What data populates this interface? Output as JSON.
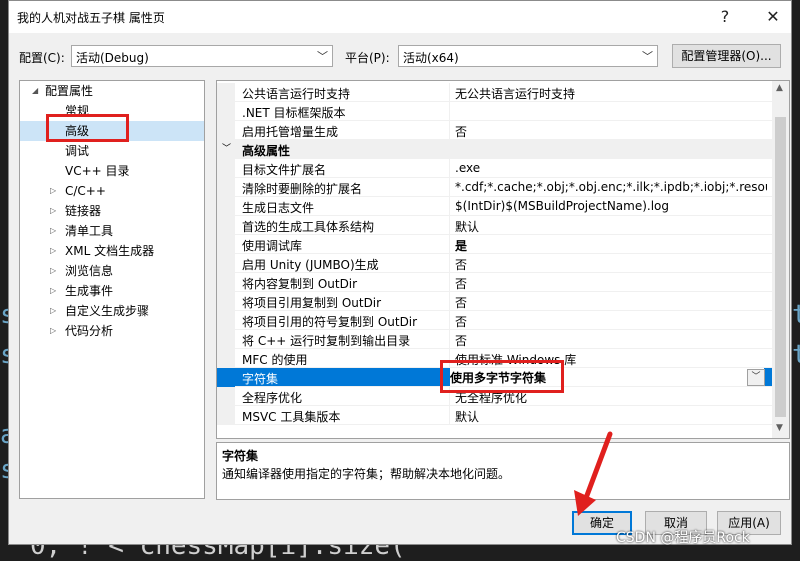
{
  "background": {
    "code_fragment": "0, ! < chessMap[i].size(",
    "left_glyphs": [
      "s",
      "s",
      "a",
      "s"
    ],
    "right_glyphs": [
      "t",
      "t"
    ]
  },
  "window": {
    "title": "我的人机对战五子棋 属性页",
    "help_label": "?",
    "close_label": "✕"
  },
  "toolbar": {
    "config_label": "配置(C):",
    "config_value": "活动(Debug)",
    "platform_label": "平台(P):",
    "platform_value": "活动(x64)",
    "config_manager_label": "配置管理器(O)..."
  },
  "tree": {
    "root": "配置属性",
    "items": [
      {
        "label": "常规",
        "expandable": false
      },
      {
        "label": "高级",
        "expandable": false,
        "selected": true
      },
      {
        "label": "调试",
        "expandable": false
      },
      {
        "label": "VC++ 目录",
        "expandable": false
      },
      {
        "label": "C/C++",
        "expandable": true
      },
      {
        "label": "链接器",
        "expandable": true
      },
      {
        "label": "清单工具",
        "expandable": true
      },
      {
        "label": "XML 文档生成器",
        "expandable": true
      },
      {
        "label": "浏览信息",
        "expandable": true
      },
      {
        "label": "生成事件",
        "expandable": true
      },
      {
        "label": "自定义生成步骤",
        "expandable": true
      },
      {
        "label": "代码分析",
        "expandable": true
      }
    ]
  },
  "grid": {
    "top_rows": [
      {
        "name": "公共语言运行时支持",
        "value": "无公共语言运行时支持"
      },
      {
        "name": ".NET 目标框架版本",
        "value": ""
      },
      {
        "name": "启用托管增量生成",
        "value": "否"
      }
    ],
    "category": "高级属性",
    "rows": [
      {
        "name": "目标文件扩展名",
        "value": ".exe"
      },
      {
        "name": "清除时要删除的扩展名",
        "value": "*.cdf;*.cache;*.obj;*.obj.enc;*.ilk;*.ipdb;*.iobj;*.resource"
      },
      {
        "name": "生成日志文件",
        "value": "$(IntDir)$(MSBuildProjectName).log"
      },
      {
        "name": "首选的生成工具体系结构",
        "value": "默认"
      },
      {
        "name": "使用调试库",
        "value": "是",
        "bold": true
      },
      {
        "name": "启用 Unity (JUMBO)生成",
        "value": "否"
      },
      {
        "name": "将内容复制到 OutDir",
        "value": "否"
      },
      {
        "name": "将项目引用复制到 OutDir",
        "value": "否"
      },
      {
        "name": "将项目引用的符号复制到 OutDir",
        "value": "否"
      },
      {
        "name": "将 C++ 运行时复制到输出目录",
        "value": "否"
      },
      {
        "name": "MFC 的使用",
        "value": "使用标准 Windows 库"
      },
      {
        "name": "字符集",
        "value": "使用多字节字符集",
        "selected": true,
        "bold": true
      },
      {
        "name": "全程序优化",
        "value": "无全程序优化"
      },
      {
        "name": "MSVC 工具集版本",
        "value": "默认"
      }
    ]
  },
  "description": {
    "title": "字符集",
    "text": "通知编译器使用指定的字符集；帮助解决本地化问题。"
  },
  "buttons": {
    "ok": "确定",
    "cancel": "取消",
    "apply": "应用(A)"
  },
  "watermark": "CSDN @程序员Rock",
  "colors": {
    "highlight_red": "#e0201e",
    "selection_blue": "#0078d7",
    "tree_selection": "#cce4f7"
  }
}
